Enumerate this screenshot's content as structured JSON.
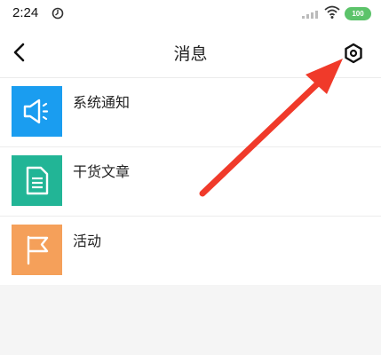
{
  "status_bar": {
    "time": "2:24",
    "battery": "100"
  },
  "header": {
    "title": "消息"
  },
  "items": [
    {
      "label": "系统通知",
      "icon": "megaphone-icon",
      "color": "#1a9df0"
    },
    {
      "label": "干货文章",
      "icon": "document-icon",
      "color": "#22b596"
    },
    {
      "label": "活动",
      "icon": "flag-icon",
      "color": "#f5a05a"
    }
  ],
  "colors": {
    "arrow": "#f03a2a",
    "separator": "#ececec",
    "background": "#f5f5f5"
  }
}
